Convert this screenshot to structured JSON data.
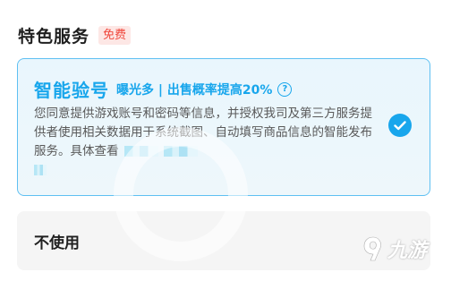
{
  "section": {
    "title": "特色服务",
    "badge": "免费"
  },
  "options": [
    {
      "title": "智能验号",
      "tagline": "曝光多 | 出售概率提高20%",
      "help_icon": "?",
      "description": "您同意提供游戏账号和密码等信息，并授权我司及第三方服务提供者使用相关数据用于系统截图、自动填写商品信息的智能发布服务。具体查看",
      "selected": true
    },
    {
      "title": "不使用",
      "selected": false
    }
  ],
  "watermark": {
    "text": "九游"
  },
  "colors": {
    "accent": "#18a6ec",
    "badge_text": "#f0473c",
    "badge_bg": "#fde7e5"
  }
}
